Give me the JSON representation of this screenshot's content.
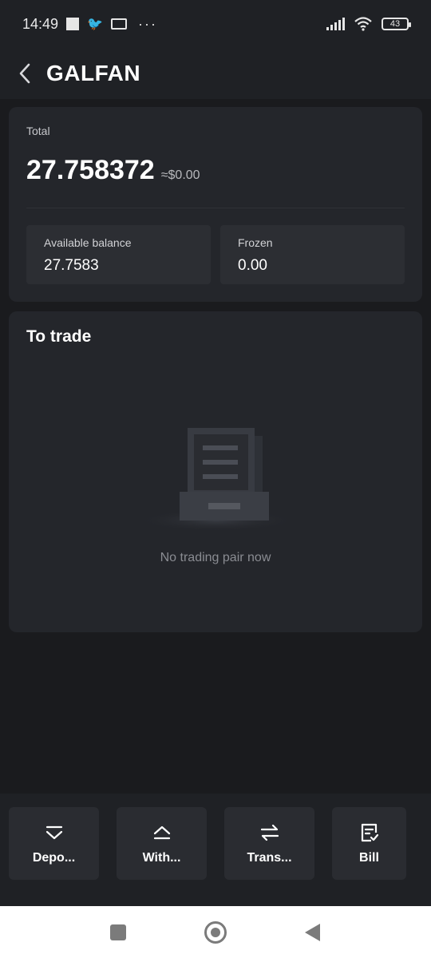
{
  "status_bar": {
    "time": "14:49",
    "battery": "43"
  },
  "header": {
    "title": "GALFAN"
  },
  "total": {
    "label": "Total",
    "value": "27.758372",
    "fiat": "≈$0.00",
    "available": {
      "label": "Available balance",
      "value": "27.7583"
    },
    "frozen": {
      "label": "Frozen",
      "value": "0.00"
    }
  },
  "trade": {
    "title": "To trade",
    "empty_text": "No trading pair now"
  },
  "actions": [
    {
      "label": "Depo...",
      "icon": "deposit-icon"
    },
    {
      "label": "With...",
      "icon": "withdraw-icon"
    },
    {
      "label": "Trans...",
      "icon": "transfer-icon"
    },
    {
      "label": "Bill",
      "icon": "bill-icon"
    }
  ],
  "colors": {
    "background": "#1a1b1e",
    "card": "#24262b",
    "box": "#2c2e33",
    "muted_text": "#8a8c92"
  }
}
